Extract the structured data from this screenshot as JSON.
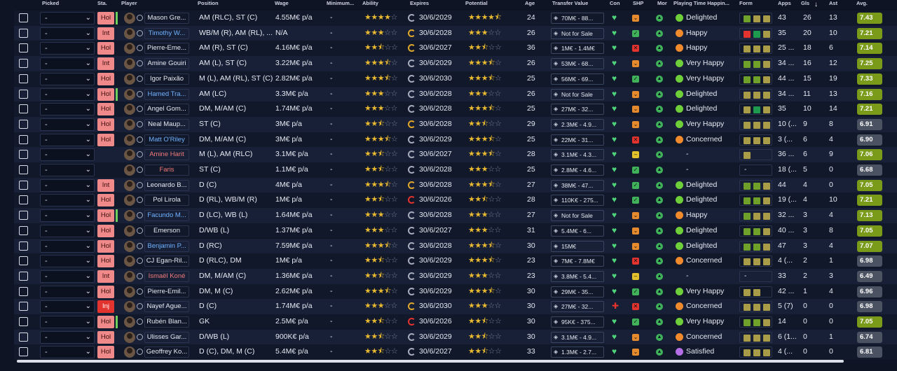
{
  "header": {
    "picked": "Picked",
    "sta": "Sta.",
    "player": "Player",
    "position": "Position",
    "wage": "Wage",
    "min_fee": "Minimum...",
    "ability": "Ability",
    "expires": "Expires",
    "potential": "Potential",
    "age": "Age",
    "transfer_value": "Transfer Value",
    "con": "Con",
    "shp": "SHP",
    "mor": "Mor",
    "playing_time": "Playing Time Happin...",
    "form": "Form",
    "apps": "Apps",
    "gls": "Gls",
    "ast": "Ast",
    "avg": "Avg."
  },
  "select_value": "-",
  "rows": [
    {
      "sta": "Hol",
      "name": "Mason Gre...",
      "name_color": "white",
      "position": "AM (RLC), ST (C)",
      "wage": "4.55M€ p/a",
      "min": "-",
      "ability": 4,
      "expires": "30/6/2029",
      "exp_icon": "grey",
      "potential": 4.5,
      "age": "24",
      "tv": "70M€ - 88...",
      "con": "green",
      "shp": "o",
      "happy": "Delighted",
      "happy_icon": "g",
      "form": [
        "g",
        "y",
        "y"
      ],
      "apps": "43",
      "gls": "26",
      "ast": "13",
      "avg": "7.43",
      "avg_style": "a1",
      "greenbar": true
    },
    {
      "sta": "Int",
      "name": "Timothy W...",
      "name_color": "blue",
      "position": "WB/M (R), AM (RL), ...",
      "wage": "N/A",
      "min": "-",
      "ability": 3,
      "expires": "30/6/2028",
      "exp_icon": "orange",
      "potential": 3,
      "age": "26",
      "tv": "Not for Sale",
      "con": "green",
      "shp": "g",
      "happy": "Happy",
      "happy_icon": "o",
      "form": [
        "r",
        "dg",
        "y"
      ],
      "apps": "35",
      "gls": "20",
      "ast": "10",
      "avg": "7.21",
      "avg_style": "a1",
      "greenbar": false
    },
    {
      "sta": "Hol",
      "name": "Pierre-Eme...",
      "name_color": "white",
      "position": "AM (R), ST (C)",
      "wage": "4.16M€ p/a",
      "min": "-",
      "ability": 2.5,
      "expires": "30/6/2027",
      "exp_icon": "orange",
      "potential": 2.5,
      "age": "36",
      "tv": "1M€ - 1.4M€",
      "con": "green",
      "shp": "r",
      "happy": "Happy",
      "happy_icon": "o",
      "form": [
        "y",
        "y",
        "y"
      ],
      "apps": "25 ...",
      "gls": "18",
      "ast": "6",
      "avg": "7.14",
      "avg_style": "a1",
      "greenbar": false
    },
    {
      "sta": "Int",
      "name": "Amine Gouiri",
      "name_color": "white",
      "position": "AM (L), ST (C)",
      "wage": "3.22M€ p/a",
      "min": "-",
      "ability": 3.5,
      "expires": "30/6/2029",
      "exp_icon": "grey",
      "potential": 3.5,
      "age": "26",
      "tv": "53M€ - 68...",
      "con": "green",
      "shp": "o",
      "happy": "Very Happy",
      "happy_icon": "g",
      "form": [
        "g",
        "g",
        "y"
      ],
      "apps": "34 ...",
      "gls": "16",
      "ast": "12",
      "avg": "7.25",
      "avg_style": "a1",
      "greenbar": false
    },
    {
      "sta": "Hol",
      "name": "Igor Paixão",
      "name_color": "white",
      "position": "M (L), AM (RL), ST (C)",
      "wage": "2.82M€ p/a",
      "min": "-",
      "ability": 3.5,
      "expires": "30/6/2030",
      "exp_icon": "grey",
      "potential": 3.5,
      "age": "25",
      "tv": "56M€ - 69...",
      "con": "green",
      "shp": "g",
      "happy": "Very Happy",
      "happy_icon": "g",
      "form": [
        "g",
        "g",
        "y"
      ],
      "apps": "44 ...",
      "gls": "15",
      "ast": "19",
      "avg": "7.33",
      "avg_style": "a1",
      "greenbar": false
    },
    {
      "sta": "Hol",
      "name": "Hamed Tra...",
      "name_color": "blue",
      "position": "AM (LC)",
      "wage": "3.3M€ p/a",
      "min": "-",
      "ability": 3,
      "expires": "30/6/2028",
      "exp_icon": "grey",
      "potential": 3,
      "age": "26",
      "tv": "Not for Sale",
      "con": "green",
      "shp": "o",
      "happy": "Delighted",
      "happy_icon": "g",
      "form": [
        "y",
        "y",
        "y"
      ],
      "apps": "34 ...",
      "gls": "11",
      "ast": "13",
      "avg": "7.16",
      "avg_style": "a1",
      "greenbar": true
    },
    {
      "sta": "Hol",
      "name": "Angel Gom...",
      "name_color": "white",
      "position": "DM, M/AM (C)",
      "wage": "1.74M€ p/a",
      "min": "-",
      "ability": 3,
      "expires": "30/6/2028",
      "exp_icon": "grey",
      "potential": 3.5,
      "age": "25",
      "tv": "27M€ - 32...",
      "con": "green",
      "shp": "o",
      "happy": "Delighted",
      "happy_icon": "g",
      "form": [
        "y",
        "dg",
        "y"
      ],
      "apps": "35",
      "gls": "10",
      "ast": "14",
      "avg": "7.21",
      "avg_style": "a1",
      "greenbar": false
    },
    {
      "sta": "Hol",
      "name": "Neal Maup...",
      "name_color": "white",
      "position": "ST (C)",
      "wage": "3M€ p/a",
      "min": "-",
      "ability": 2.5,
      "expires": "30/6/2028",
      "exp_icon": "orange",
      "potential": 2.5,
      "age": "29",
      "tv": "2.3M€ - 4.9...",
      "con": "green",
      "shp": "o",
      "happy": "Very Happy",
      "happy_icon": "g",
      "form": [
        "y",
        "y",
        "y"
      ],
      "apps": "10 (...",
      "gls": "9",
      "ast": "8",
      "avg": "6.91",
      "avg_style": "a3",
      "greenbar": false
    },
    {
      "sta": "Hol",
      "name": "Matt O'Riley",
      "name_color": "blue",
      "position": "DM, M/AM (C)",
      "wage": "3M€ p/a",
      "min": "-",
      "ability": 3.5,
      "expires": "30/6/2029",
      "exp_icon": "grey",
      "potential": 3.5,
      "age": "25",
      "tv": "22M€ - 31...",
      "con": "green",
      "shp": "r",
      "happy": "Concerned",
      "happy_icon": "o",
      "form": [
        "y",
        "y",
        "y"
      ],
      "apps": "3 (...",
      "gls": "6",
      "ast": "4",
      "avg": "6.90",
      "avg_style": "a3",
      "greenbar": false
    },
    {
      "sta": "",
      "name": "Amine Harit",
      "name_color": "red",
      "position": "M (L), AM (RLC)",
      "wage": "3.1M€ p/a",
      "min": "-",
      "ability": 2.5,
      "expires": "30/6/2027",
      "exp_icon": "grey",
      "potential": 3.5,
      "age": "28",
      "tv": "3.1M€ - 4.3...",
      "con": "green",
      "shp": "y",
      "happy": "-",
      "happy_icon": "",
      "form": [
        "y"
      ],
      "apps": "36 ...",
      "gls": "6",
      "ast": "9",
      "avg": "7.06",
      "avg_style": "a1",
      "greenbar": false
    },
    {
      "sta": "",
      "name": "Faris",
      "name_color": "red",
      "position": "ST (C)",
      "wage": "1.1M€ p/a",
      "min": "-",
      "ability": 2.5,
      "expires": "30/6/2028",
      "exp_icon": "grey",
      "potential": 3,
      "age": "25",
      "tv": "2.8M€ - 4.6...",
      "con": "green",
      "shp": "g",
      "happy": "-",
      "happy_icon": "",
      "form": [],
      "apps": "18 (...",
      "gls": "5",
      "ast": "0",
      "avg": "6.68",
      "avg_style": "a3",
      "greenbar": false
    },
    {
      "sta": "Int",
      "name": "Leonardo B...",
      "name_color": "white",
      "position": "D (C)",
      "wage": "4M€ p/a",
      "min": "-",
      "ability": 3.5,
      "expires": "30/6/2028",
      "exp_icon": "orange",
      "potential": 3.5,
      "age": "27",
      "tv": "38M€ - 47...",
      "con": "green",
      "shp": "g",
      "happy": "Delighted",
      "happy_icon": "g",
      "form": [
        "g",
        "g",
        "y"
      ],
      "apps": "44",
      "gls": "4",
      "ast": "0",
      "avg": "7.05",
      "avg_style": "a1",
      "greenbar": false
    },
    {
      "sta": "Hol",
      "name": "Pol Lirola",
      "name_color": "white",
      "position": "D (RL), WB/M (R)",
      "wage": "1M€ p/a",
      "min": "-",
      "ability": 2.5,
      "expires": "30/6/2026",
      "exp_icon": "red",
      "potential": 2.5,
      "age": "28",
      "tv": "110K€ - 275...",
      "con": "green",
      "shp": "g",
      "happy": "Delighted",
      "happy_icon": "g",
      "form": [
        "g",
        "g",
        "y"
      ],
      "apps": "19 (...",
      "gls": "4",
      "ast": "10",
      "avg": "7.21",
      "avg_style": "a1",
      "greenbar": false
    },
    {
      "sta": "Hol",
      "name": "Facundo M...",
      "name_color": "blue",
      "position": "D (LC), WB (L)",
      "wage": "1.64M€ p/a",
      "min": "-",
      "ability": 3,
      "expires": "30/6/2028",
      "exp_icon": "grey",
      "potential": 3,
      "age": "27",
      "tv": "Not for Sale",
      "con": "green",
      "shp": "o",
      "happy": "Happy",
      "happy_icon": "o",
      "form": [
        "g",
        "y",
        "y"
      ],
      "apps": "32 ...",
      "gls": "3",
      "ast": "4",
      "avg": "7.13",
      "avg_style": "a1",
      "greenbar": true
    },
    {
      "sta": "Hol",
      "name": "Emerson",
      "name_color": "white",
      "position": "D/WB (L)",
      "wage": "1.37M€ p/a",
      "min": "-",
      "ability": 3,
      "expires": "30/6/2027",
      "exp_icon": "grey",
      "potential": 3,
      "age": "31",
      "tv": "5.4M€ - 6...",
      "con": "green",
      "shp": "o",
      "happy": "Delighted",
      "happy_icon": "g",
      "form": [
        "g",
        "g",
        "y"
      ],
      "apps": "40 ...",
      "gls": "3",
      "ast": "8",
      "avg": "7.05",
      "avg_style": "a1",
      "greenbar": false
    },
    {
      "sta": "Hol",
      "name": "Benjamin P...",
      "name_color": "blue",
      "position": "D (RC)",
      "wage": "7.59M€ p/a",
      "min": "-",
      "ability": 3.5,
      "expires": "30/6/2028",
      "exp_icon": "grey",
      "potential": 3.5,
      "age": "30",
      "tv": "15M€",
      "con": "green",
      "shp": "o",
      "happy": "Delighted",
      "happy_icon": "g",
      "form": [
        "g",
        "g",
        "y"
      ],
      "apps": "47",
      "gls": "3",
      "ast": "4",
      "avg": "7.07",
      "avg_style": "a1",
      "greenbar": false
    },
    {
      "sta": "Hol",
      "name": "CJ Egan-Ril...",
      "name_color": "white",
      "position": "D (RLC), DM",
      "wage": "1M€ p/a",
      "min": "-",
      "ability": 2.5,
      "expires": "30/6/2029",
      "exp_icon": "grey",
      "potential": 3.5,
      "age": "23",
      "tv": "7M€ - 7.8M€",
      "con": "green",
      "shp": "r",
      "happy": "Concerned",
      "happy_icon": "o",
      "form": [
        "y",
        "y",
        "y"
      ],
      "apps": "4 (...",
      "gls": "2",
      "ast": "1",
      "avg": "6.98",
      "avg_style": "a3",
      "greenbar": false
    },
    {
      "sta": "Int",
      "name": "Ismaël Koné",
      "name_color": "red",
      "position": "DM, M/AM (C)",
      "wage": "1.36M€ p/a",
      "min": "-",
      "ability": 2.5,
      "expires": "30/6/2029",
      "exp_icon": "grey",
      "potential": 3,
      "age": "23",
      "tv": "3.8M€ - 5.4...",
      "con": "green",
      "shp": "y",
      "happy": "-",
      "happy_icon": "",
      "form": [],
      "apps": "33",
      "gls": "2",
      "ast": "3",
      "avg": "6.49",
      "avg_style": "a3",
      "greenbar": false
    },
    {
      "sta": "Hol",
      "name": "Pierre-Emil...",
      "name_color": "white",
      "position": "DM, M (C)",
      "wage": "2.62M€ p/a",
      "min": "-",
      "ability": 3.5,
      "expires": "30/6/2029",
      "exp_icon": "grey",
      "potential": 3.5,
      "age": "30",
      "tv": "29M€ - 35...",
      "con": "green",
      "shp": "g",
      "happy": "Very Happy",
      "happy_icon": "g",
      "form": [
        "y",
        "y"
      ],
      "apps": "42 ...",
      "gls": "1",
      "ast": "4",
      "avg": "6.96",
      "avg_style": "a3",
      "greenbar": false
    },
    {
      "sta": "Inj",
      "name": "Nayef Ague...",
      "name_color": "white",
      "position": "D (C)",
      "wage": "1.74M€ p/a",
      "min": "-",
      "ability": 3,
      "expires": "30/6/2030",
      "exp_icon": "orange",
      "potential": 3,
      "age": "30",
      "tv": "27M€ - 32...",
      "con": "red",
      "shp": "r",
      "happy": "Concerned",
      "happy_icon": "o",
      "form": [
        "y",
        "y",
        "y"
      ],
      "apps": "5 (7)",
      "gls": "0",
      "ast": "0",
      "avg": "6.98",
      "avg_style": "a3",
      "greenbar": false
    },
    {
      "sta": "Hol",
      "name": "Rubén Blan...",
      "name_color": "white",
      "position": "GK",
      "wage": "2.5M€ p/a",
      "min": "-",
      "ability": 2.5,
      "expires": "30/6/2026",
      "exp_icon": "red",
      "potential": 2.5,
      "age": "30",
      "tv": "95K€ - 375...",
      "con": "green",
      "shp": "g",
      "happy": "Very Happy",
      "happy_icon": "g",
      "form": [
        "g",
        "g",
        "y"
      ],
      "apps": "14",
      "gls": "0",
      "ast": "0",
      "avg": "7.05",
      "avg_style": "a1",
      "greenbar": true
    },
    {
      "sta": "Hol",
      "name": "Ulisses Gar...",
      "name_color": "white",
      "position": "D/WB (L)",
      "wage": "900K€ p/a",
      "min": "-",
      "ability": 2.5,
      "expires": "30/6/2029",
      "exp_icon": "grey",
      "potential": 2.5,
      "age": "30",
      "tv": "3.1M€ - 4.9...",
      "con": "green",
      "shp": "o",
      "happy": "Concerned",
      "happy_icon": "o",
      "form": [
        "y",
        "y",
        "y"
      ],
      "apps": "6 (1...",
      "gls": "0",
      "ast": "1",
      "avg": "6.74",
      "avg_style": "a3",
      "greenbar": false
    },
    {
      "sta": "Hol",
      "name": "Geoffrey Ko...",
      "name_color": "white",
      "position": "D (C), DM, M (C)",
      "wage": "5.4M€ p/a",
      "min": "-",
      "ability": 2.5,
      "expires": "30/6/2027",
      "exp_icon": "grey",
      "potential": 2.5,
      "age": "33",
      "tv": "1.3M€ - 2.7...",
      "con": "green",
      "shp": "o",
      "happy": "Satisfied",
      "happy_icon": "p",
      "form": [
        "y",
        "y",
        "y"
      ],
      "apps": "4 (...",
      "gls": "0",
      "ast": "0",
      "avg": "6.81",
      "avg_style": "a3",
      "greenbar": false
    }
  ]
}
